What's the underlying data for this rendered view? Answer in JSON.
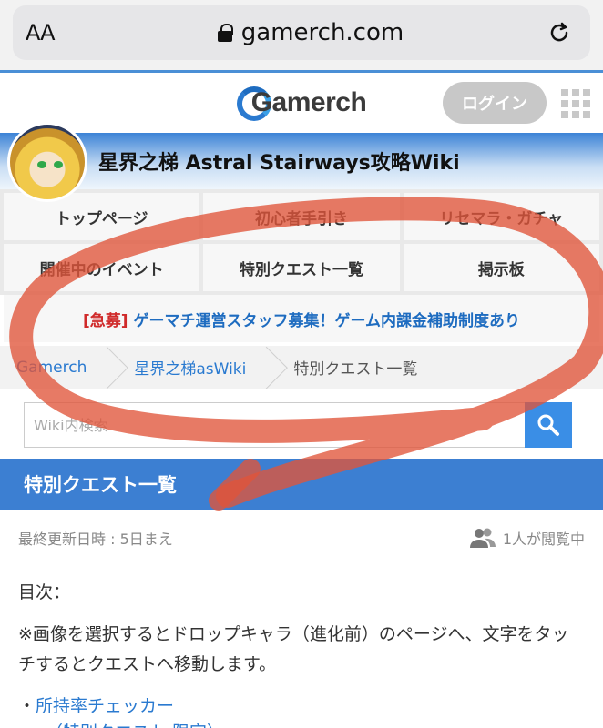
{
  "browser": {
    "text_size_label": "AA",
    "url": "gamerch.com"
  },
  "header": {
    "logo_text": "Gamerch",
    "login_label": "ログイン"
  },
  "wiki": {
    "title": "星界之梯 Astral Stairways攻略Wiki"
  },
  "nav": {
    "items": [
      {
        "label": "トップページ"
      },
      {
        "label": "初心者手引き"
      },
      {
        "label": "リセマラ・ガチャ"
      },
      {
        "label": "開催中のイベント"
      },
      {
        "label": "特別クエスト一覧"
      },
      {
        "label": "掲示板"
      }
    ],
    "notice_tag": "[急募]",
    "notice_text": "ゲーマチ運営スタッフ募集！ゲーム内課金補助制度あり"
  },
  "breadcrumb": {
    "items": [
      {
        "label": "Gamerch"
      },
      {
        "label": "星界之梯asWiki"
      },
      {
        "label": "特別クエスト一覧"
      }
    ]
  },
  "search": {
    "placeholder": "Wiki内検索"
  },
  "page": {
    "title": "特別クエスト一覧",
    "updated": "最終更新日時 : 5日まえ",
    "viewers": "1人が閲覧中",
    "toc_label": "目次：",
    "description": "※画像を選択するとドロップキャラ（進化前）のページへ、文字をタッチするとクエストへ移動します。",
    "link_bullet": "・",
    "link_1": "所持率チェッカー",
    "link_2": "（特別クエスト 限定）"
  },
  "colors": {
    "accent": "#3c7fd2",
    "link": "#2a7ad0",
    "urgent": "#d02a2a",
    "annotation": "#e0553a"
  }
}
